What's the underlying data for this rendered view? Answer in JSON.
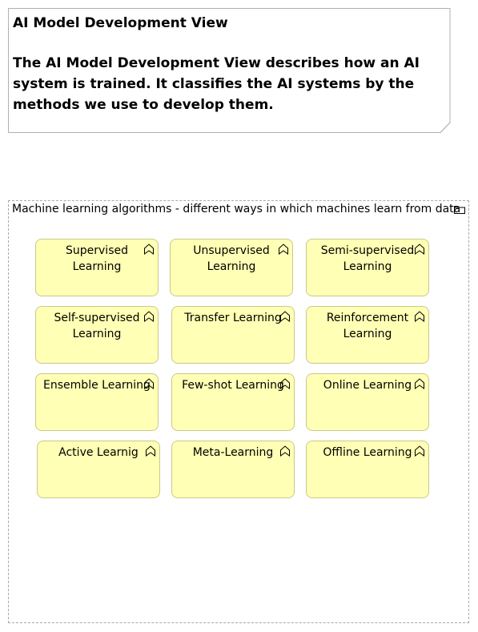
{
  "note": {
    "title": "AI Model Development View",
    "description": "The AI Model Development View describes how an AI system is trained. It classifies the AI systems by the methods we use to develop them."
  },
  "group": {
    "label": "Machine learning algorithms - different ways in which machines learn from data",
    "icon": "folder-icon"
  },
  "functions": [
    {
      "label": "Supervised Learning",
      "icon": "function-icon"
    },
    {
      "label": "Unsupervised Learning",
      "icon": "function-icon"
    },
    {
      "label": "Semi-supervised Learning",
      "icon": "function-icon"
    },
    {
      "label": "Self-supervised Learning",
      "icon": "function-icon"
    },
    {
      "label": "Transfer Learning",
      "icon": "function-icon"
    },
    {
      "label": "Reinforcement Learning",
      "icon": "function-icon"
    },
    {
      "label": "Ensemble Learning",
      "icon": "function-icon"
    },
    {
      "label": "Few-shot Learning",
      "icon": "function-icon"
    },
    {
      "label": "Online Learning",
      "icon": "function-icon"
    },
    {
      "label": "Active Learnig",
      "icon": "function-icon"
    },
    {
      "label": "Meta-Learning",
      "icon": "function-icon"
    },
    {
      "label": "Offline Learning",
      "icon": "function-icon"
    }
  ],
  "colors": {
    "function_fill": "#ffffb5",
    "function_border": "#c9c98a",
    "group_border": "#a9a9a9",
    "note_border": "#b0b0b0"
  }
}
